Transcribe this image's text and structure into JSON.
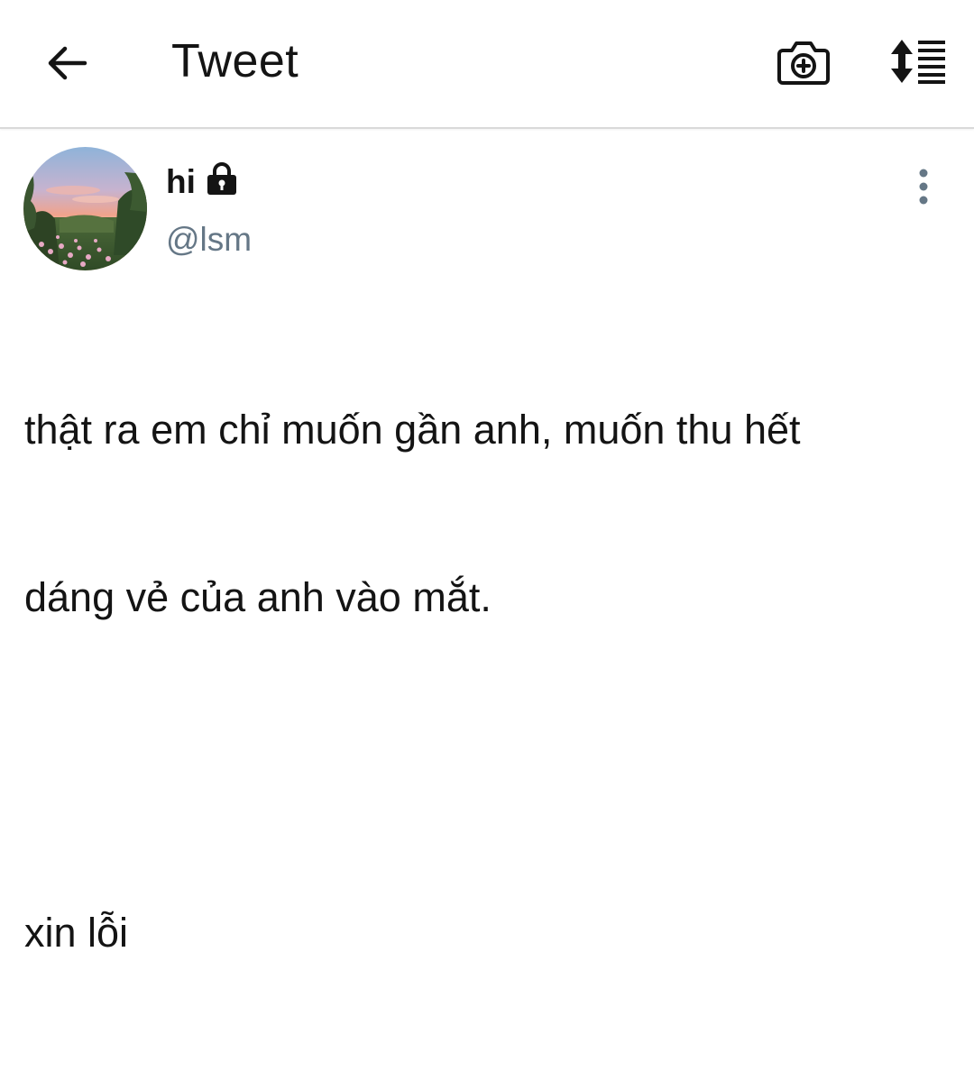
{
  "header": {
    "title": "Tweet",
    "back_icon": "arrow-left-icon",
    "camera_icon": "camera-plus-icon",
    "sort_icon": "sort-lines-icon"
  },
  "tweet": {
    "display_name": "hi",
    "protected_icon": "lock-icon",
    "handle": "@lsm",
    "more_icon": "more-vertical-icon",
    "text_line1": "thật ra em chỉ muốn gần anh, muốn thu hết",
    "text_line2": "dáng vẻ của anh vào mắt.",
    "text_line3": "xin lỗi"
  },
  "colors": {
    "text": "#141414",
    "handle": "#657786",
    "divider": "#d9d9d9",
    "more_dots": "#657786"
  }
}
